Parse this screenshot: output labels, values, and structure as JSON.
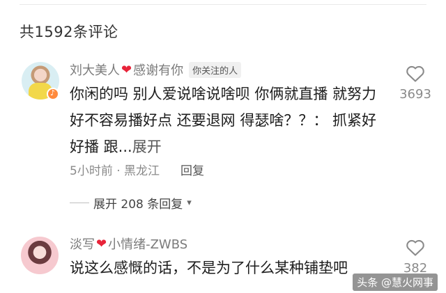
{
  "header": {
    "comment_count": "共1592条评论"
  },
  "comments": [
    {
      "name_prefix": "刘大美人",
      "name_suffix": "感谢有你",
      "tag": "你关注的人",
      "text": "你闲的吗 别人爱说啥说啥呗 你俩就直播 就努力 好不容易播好点 还要退网 得瑟啥？？： 抓紧好好播 跟...",
      "expand": "展开",
      "time_location": "5小时前 · 黑龙江",
      "reply": "回复",
      "likes": "3693",
      "more_replies": "展开 208 条回复"
    },
    {
      "name_prefix": "淡写",
      "name_suffix": "小情绪-ZWBS",
      "text": "说这么感慨的话，不是为了什么某种铺垫吧",
      "likes": "382"
    }
  ],
  "watermark": "头条 @慧火网事",
  "icons": {
    "like": "heart-outline-icon",
    "heart": "red-heart-icon",
    "chevron": "chevron-down-icon"
  },
  "colors": {
    "heart": "#e8243a",
    "badge": "#ff8a3d"
  }
}
